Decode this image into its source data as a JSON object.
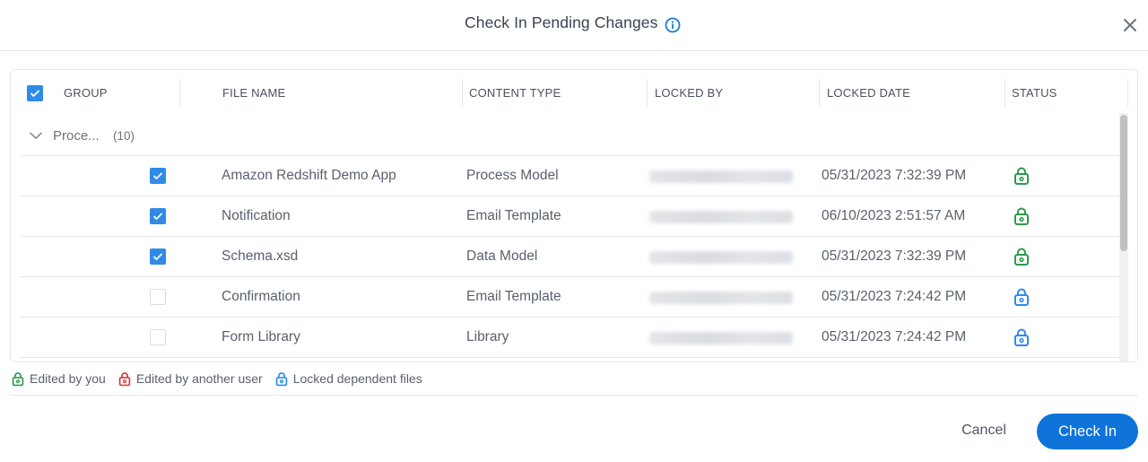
{
  "dialog": {
    "title": "Check In Pending Changes",
    "info_icon": "info-icon",
    "close_icon": "close-icon"
  },
  "table": {
    "select_all_checked": true,
    "columns": [
      "GROUP",
      "FILE NAME",
      "CONTENT TYPE",
      "LOCKED BY",
      "LOCKED DATE",
      "STATUS"
    ],
    "group": {
      "name": "Proce...",
      "count": "(10)",
      "expanded": true
    },
    "rows": [
      {
        "checked": true,
        "file_name": "Amazon Redshift Demo App",
        "content_type": "Process Model",
        "locked_by": "(blurred)",
        "locked_date": "05/31/2023 7:32:39 PM",
        "status": "edited-by-you"
      },
      {
        "checked": true,
        "file_name": "Notification",
        "content_type": "Email Template",
        "locked_by": "(blurred)",
        "locked_date": "06/10/2023 2:51:57 AM",
        "status": "edited-by-you"
      },
      {
        "checked": true,
        "file_name": "Schema.xsd",
        "content_type": "Data Model",
        "locked_by": "(blurred)",
        "locked_date": "05/31/2023 7:32:39 PM",
        "status": "edited-by-you"
      },
      {
        "checked": false,
        "file_name": "Confirmation",
        "content_type": "Email Template",
        "locked_by": "(blurred)",
        "locked_date": "05/31/2023 7:24:42 PM",
        "status": "locked-dependent"
      },
      {
        "checked": false,
        "file_name": "Form Library",
        "content_type": "Library",
        "locked_by": "(blurred)",
        "locked_date": "05/31/2023 7:24:42 PM",
        "status": "locked-dependent"
      }
    ]
  },
  "legend": [
    {
      "label": "Edited by you",
      "color": "#2e9a4f",
      "icon": "lock-icon"
    },
    {
      "label": "Edited by another user",
      "color": "#d13d3d",
      "icon": "lock-icon"
    },
    {
      "label": "Locked dependent files",
      "color": "#2f8be6",
      "icon": "lock-icon"
    }
  ],
  "colors": {
    "accent": "#0f74d9",
    "checkbox": "#2f8be6",
    "edited_by_you": "#2e9a4f",
    "edited_by_another": "#d13d3d",
    "locked_dependent": "#2f8be6"
  },
  "footer": {
    "cancel_label": "Cancel",
    "check_in_label": "Check In"
  }
}
